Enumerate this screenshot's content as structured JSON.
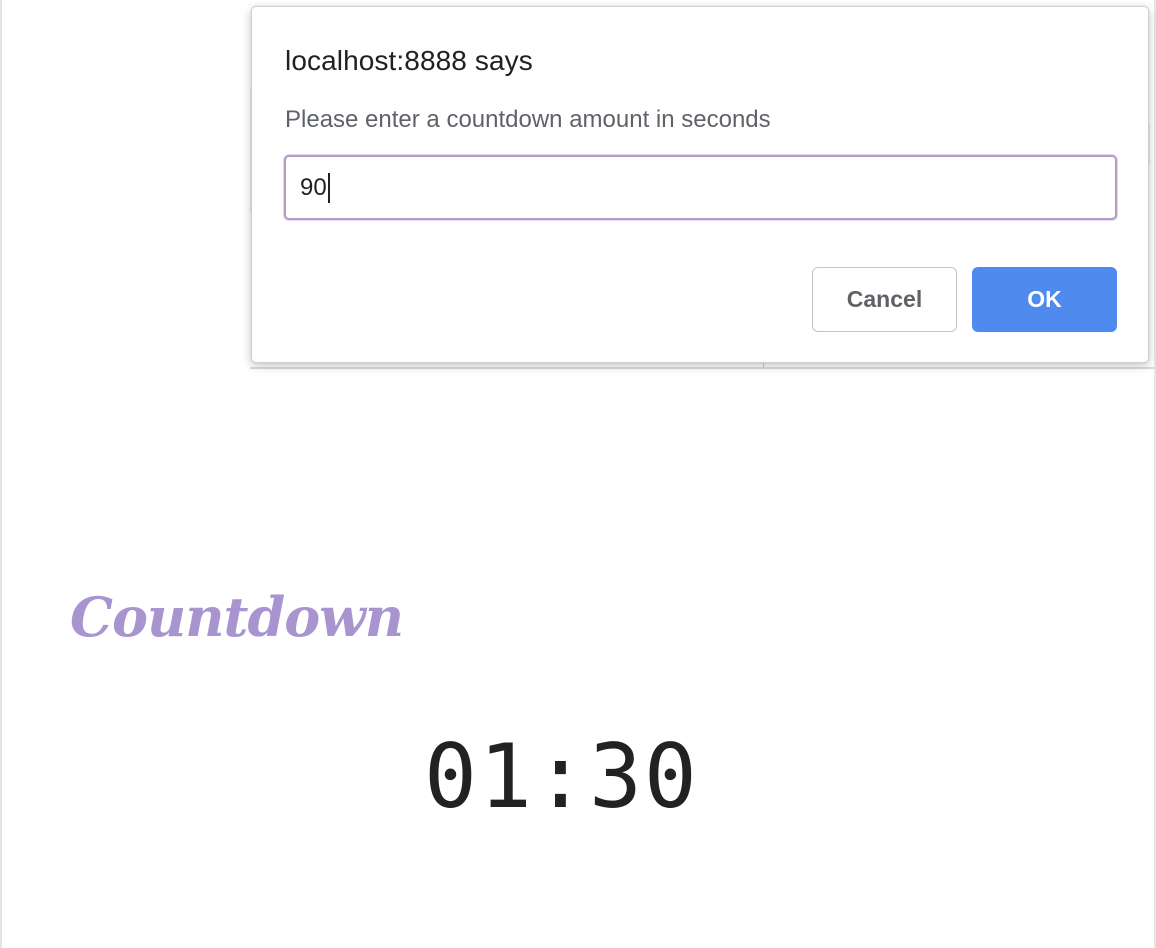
{
  "dialog": {
    "title": "localhost:8888 says",
    "message": "Please enter a countdown amount in seconds",
    "input_value": "90",
    "cancel_label": "Cancel",
    "ok_label": "OK"
  },
  "page": {
    "heading": "Countdown",
    "timer": "01:30"
  },
  "colors": {
    "ok_button": "#4f8bef",
    "heading": "#a895cf",
    "input_focus_border": "#b79ac6"
  }
}
